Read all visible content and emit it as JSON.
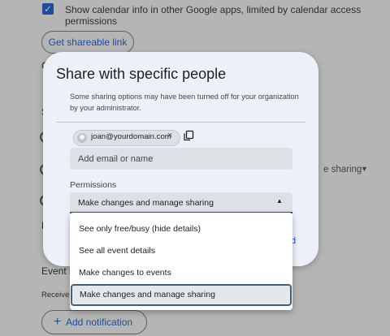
{
  "background": {
    "checkbox_mark": "✓",
    "checkbox_label": "Show calendar info in other Google apps, limited by calendar access permissions",
    "get_link_label": "Get shareable link",
    "select_value": "e sharing",
    "event_label": "Event n",
    "receive_label": "Receive n",
    "frag_c": "C",
    "frag_s": "S",
    "frag_l": "L",
    "add_notification_plus": "+",
    "add_notification_label": "Add notification"
  },
  "dialog": {
    "title": "Share with specific people",
    "note": "Some sharing options may have been turned off for your organization by your administrator.",
    "chip_email": "joan@yourdomain.com",
    "chip_remove": "×",
    "email_placeholder": "Add email or name",
    "permissions_label": "Permissions",
    "permissions_value": "Make changes and manage sharing",
    "permissions_arrow": "▲",
    "link_fragment": "d"
  },
  "menu": {
    "items": [
      "See only free/busy (hide details)",
      "See all event details",
      "Make changes to events",
      "Make changes and manage sharing"
    ],
    "selected": "Make changes and manage sharing"
  },
  "colors": {
    "accent": "#0b57d0",
    "dialog_bg": "#ecf0f8",
    "field_bg": "#dde1e6"
  }
}
